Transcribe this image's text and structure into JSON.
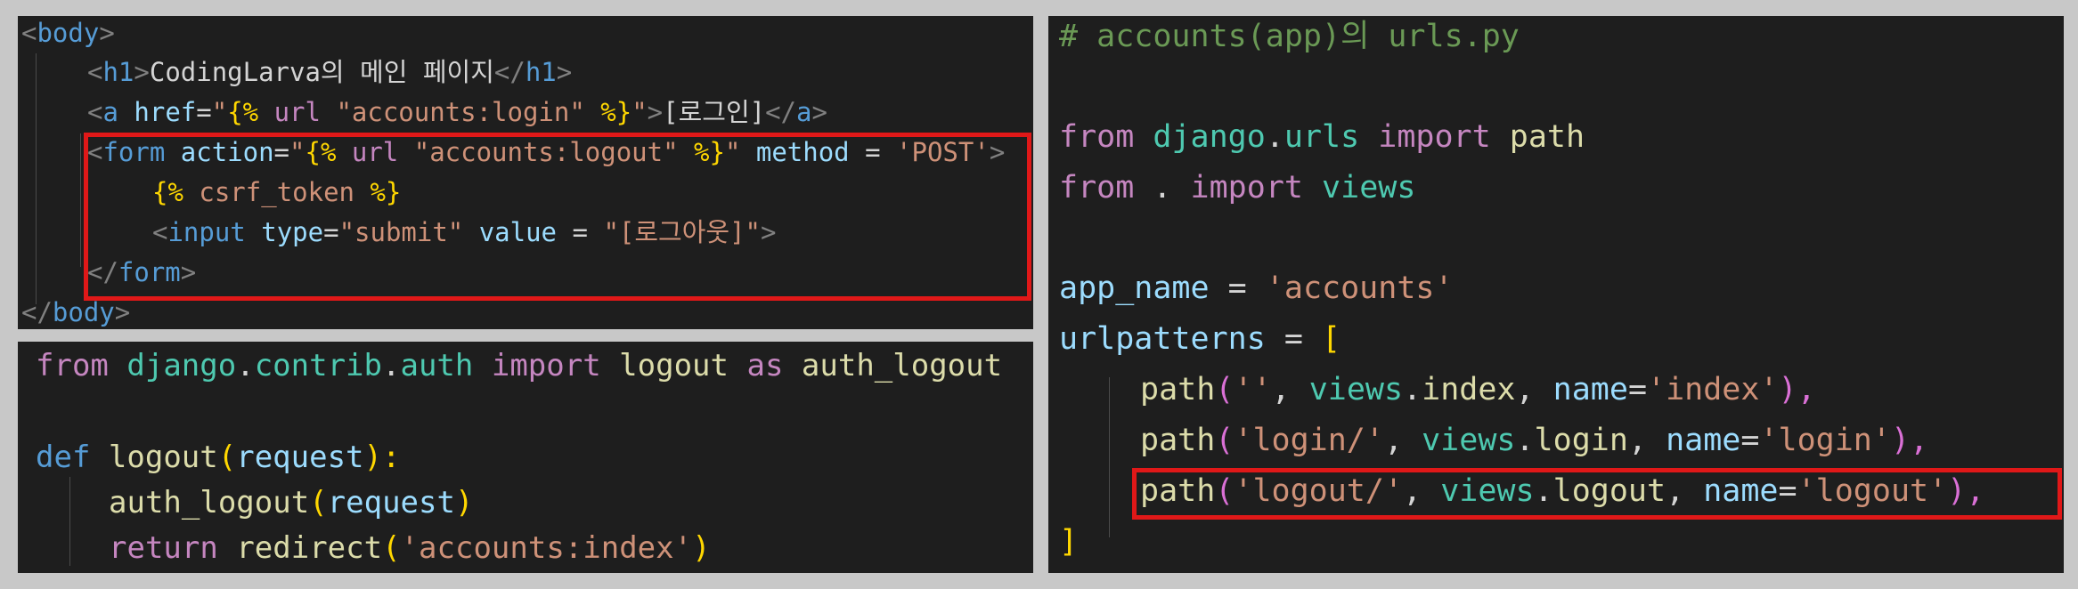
{
  "html_panel": {
    "lines": [
      [
        "<",
        "body",
        ">"
      ],
      [
        "<",
        "h1",
        ">",
        "CodingLarva의 메인 페이지",
        "</",
        "h1",
        ">"
      ],
      [
        "<",
        "a",
        "href",
        "=",
        "\"",
        "{%",
        "url",
        "\"accounts:login\"",
        "%}",
        "\"",
        ">",
        "[로그인]",
        "</",
        "a",
        ">"
      ],
      [
        "<",
        "form",
        "action",
        "=",
        "\"",
        "{%",
        "url",
        "\"accounts:logout\"",
        "%}",
        "\"",
        "method",
        "=",
        "'POST'",
        ">"
      ],
      [
        "{%",
        "csrf_token",
        "%}"
      ],
      [
        "<",
        "input",
        "type",
        "=",
        "\"submit\"",
        "value",
        "=",
        "\"",
        "[로그아웃]",
        "\"",
        ">"
      ],
      [
        "</",
        "form",
        ">"
      ],
      [
        "</",
        "body",
        ">"
      ]
    ]
  },
  "views_panel": {
    "lines": [
      [
        "from",
        "django",
        ".",
        "contrib",
        ".",
        "auth",
        "import",
        "logout",
        "as",
        "auth_logout"
      ],
      [],
      [
        "def",
        "logout",
        "(",
        "request",
        "):"
      ],
      [
        "auth_logout",
        "(",
        "request",
        ")"
      ],
      [
        "return",
        "redirect",
        "(",
        "'accounts:index'",
        ")"
      ]
    ]
  },
  "urls_panel": {
    "lines": [
      [
        "# accounts(app)의 urls.py"
      ],
      [],
      [
        "from",
        "django",
        ".",
        "urls",
        "import",
        "path"
      ],
      [
        "from",
        ".",
        "import",
        "views"
      ],
      [],
      [
        "app_name",
        "=",
        "'accounts'"
      ],
      [
        "urlpatterns",
        "=",
        "["
      ],
      [
        "path",
        "(",
        "''",
        ",",
        "views",
        ".",
        "index",
        ",",
        "name",
        "=",
        "'index'",
        "),"
      ],
      [
        "path",
        "(",
        "'login/'",
        ",",
        "views",
        ".",
        "login",
        ",",
        "name",
        "=",
        "'login'",
        "),"
      ],
      [
        "path",
        "(",
        "'logout/'",
        ",",
        "views",
        ".",
        "logout",
        ",",
        "name",
        "=",
        "'logout'",
        "),"
      ],
      [
        "]"
      ]
    ]
  },
  "highlight_color": "#e01818",
  "editor_background": "#1e1e1e"
}
